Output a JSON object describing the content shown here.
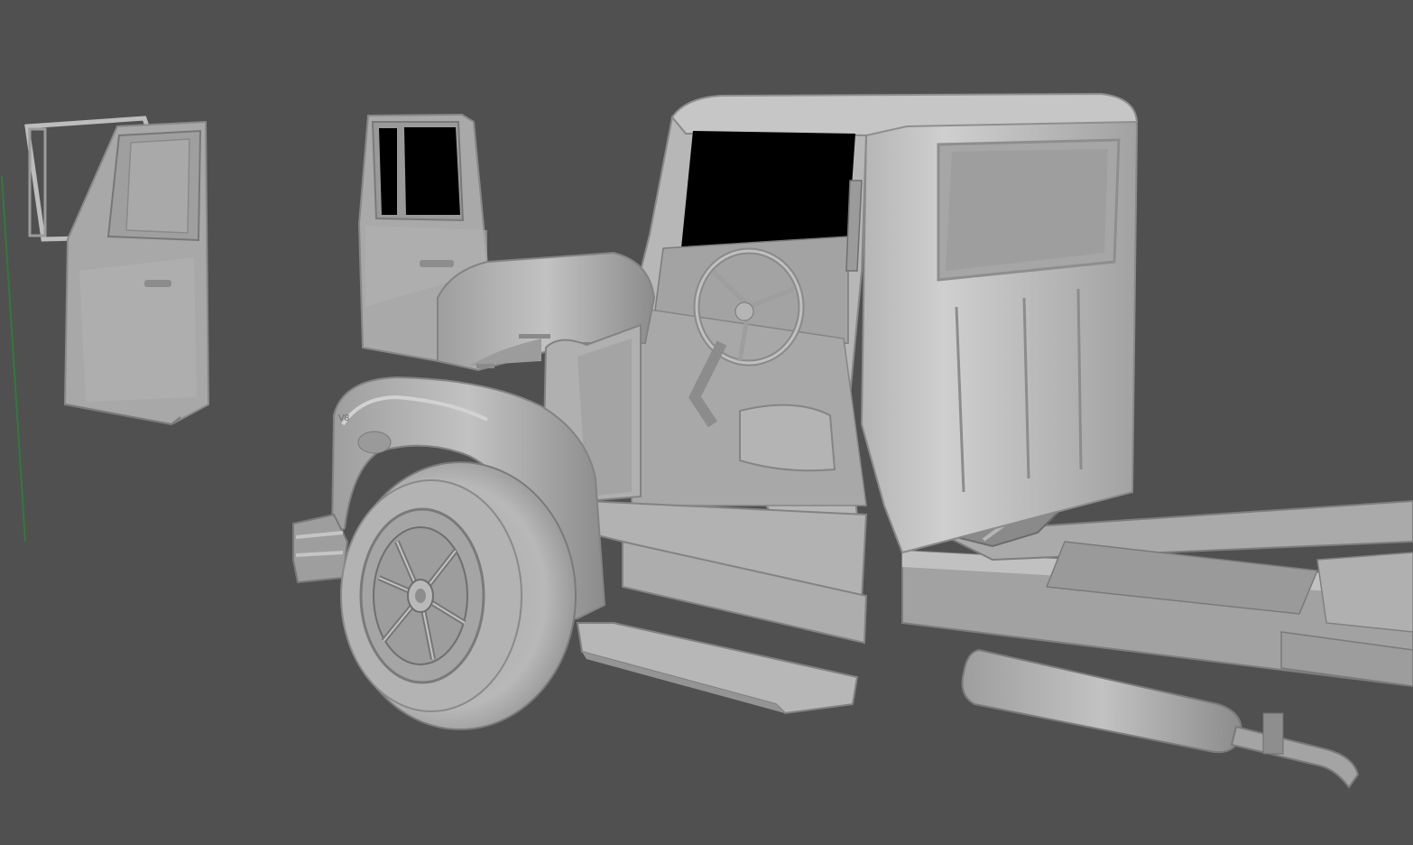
{
  "viewport": {
    "background": "#505050",
    "model_color_light": "#b9b9b9",
    "model_color_mid": "#9a9a9a",
    "model_color_dark": "#6e6e6e",
    "window_color": "#000000",
    "axis_line_color": "#2f7a3a"
  }
}
